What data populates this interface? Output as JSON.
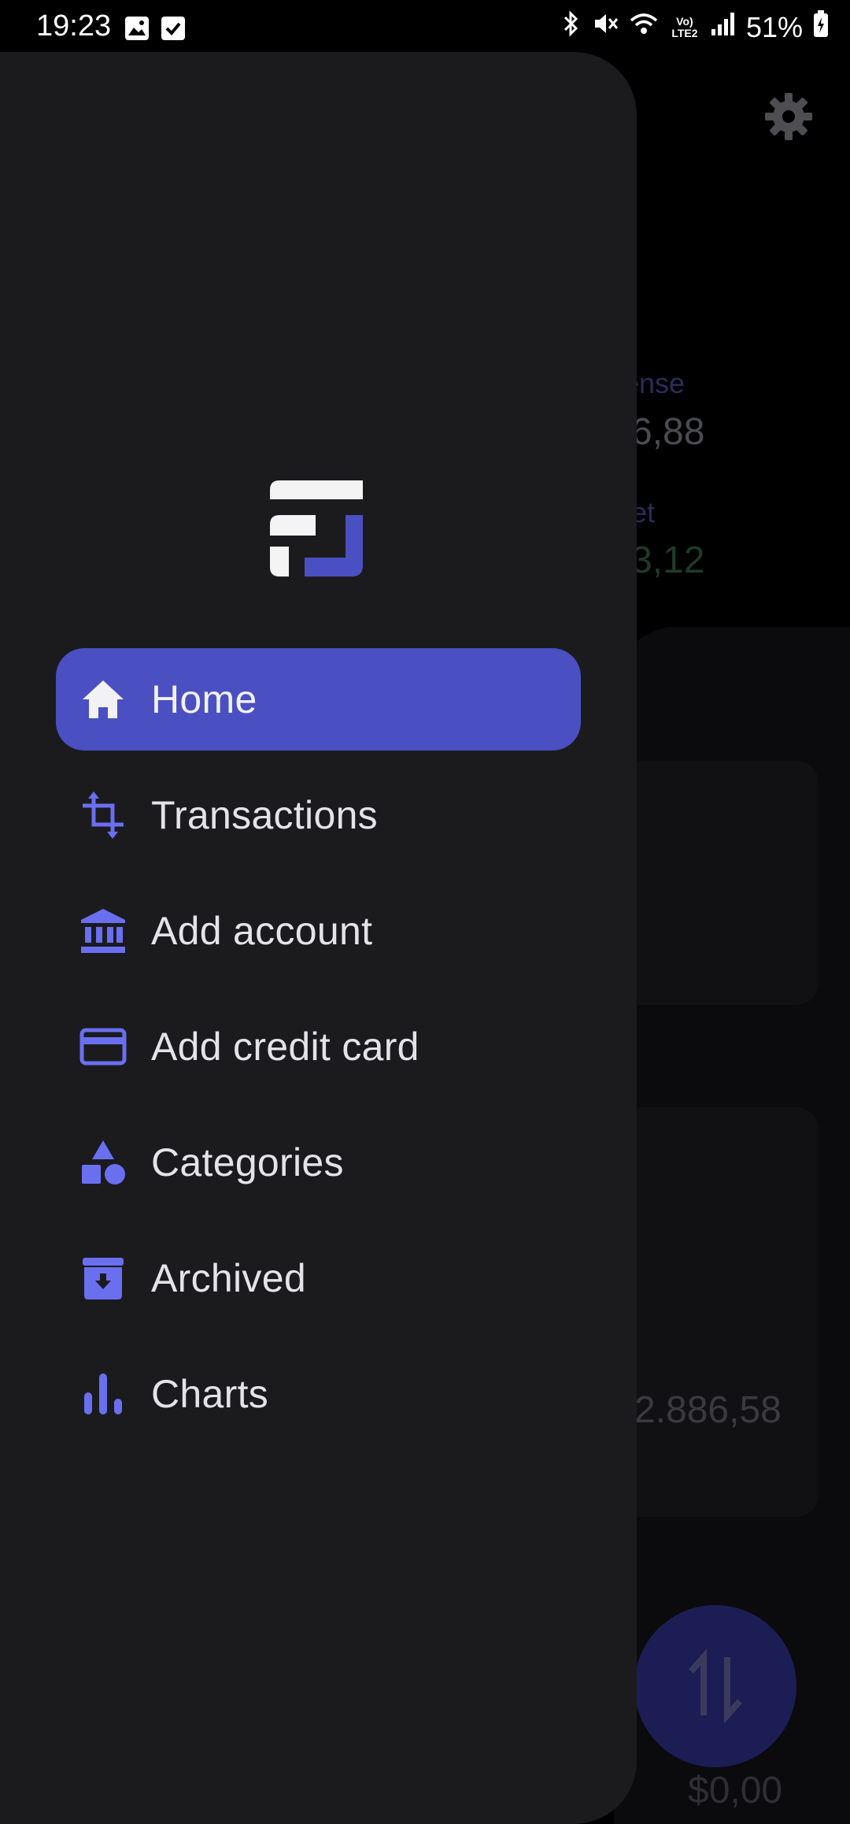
{
  "status_bar": {
    "time": "19:23",
    "battery": "51%",
    "icons": [
      "gallery-icon",
      "check-icon",
      "bluetooth-icon",
      "mute-icon",
      "wifi-icon",
      "volte-icon",
      "signal-icon",
      "battery-icon"
    ],
    "network_label": "Vo) LTE2"
  },
  "background": {
    "expense_label": "ense",
    "expense_value": "6,88",
    "net_label": "et",
    "net_value": "3,12",
    "balance_value": "2.886,58",
    "bottom_value": "$0,00"
  },
  "drawer": {
    "menu": [
      {
        "id": "home",
        "label": "Home",
        "icon": "home-icon",
        "active": true
      },
      {
        "id": "transactions",
        "label": "Transactions",
        "icon": "transactions-icon",
        "active": false
      },
      {
        "id": "add-account",
        "label": "Add account",
        "icon": "bank-icon",
        "active": false
      },
      {
        "id": "add-credit-card",
        "label": "Add credit card",
        "icon": "credit-card-icon",
        "active": false
      },
      {
        "id": "categories",
        "label": "Categories",
        "icon": "shapes-icon",
        "active": false
      },
      {
        "id": "archived",
        "label": "Archived",
        "icon": "archive-icon",
        "active": false
      },
      {
        "id": "charts",
        "label": "Charts",
        "icon": "bar-chart-icon",
        "active": false
      }
    ]
  },
  "colors": {
    "accent": "#4a50c2",
    "icon_accent": "#6a6ff0",
    "drawer_bg": "#1b1b1e",
    "scrim": "#000000"
  }
}
